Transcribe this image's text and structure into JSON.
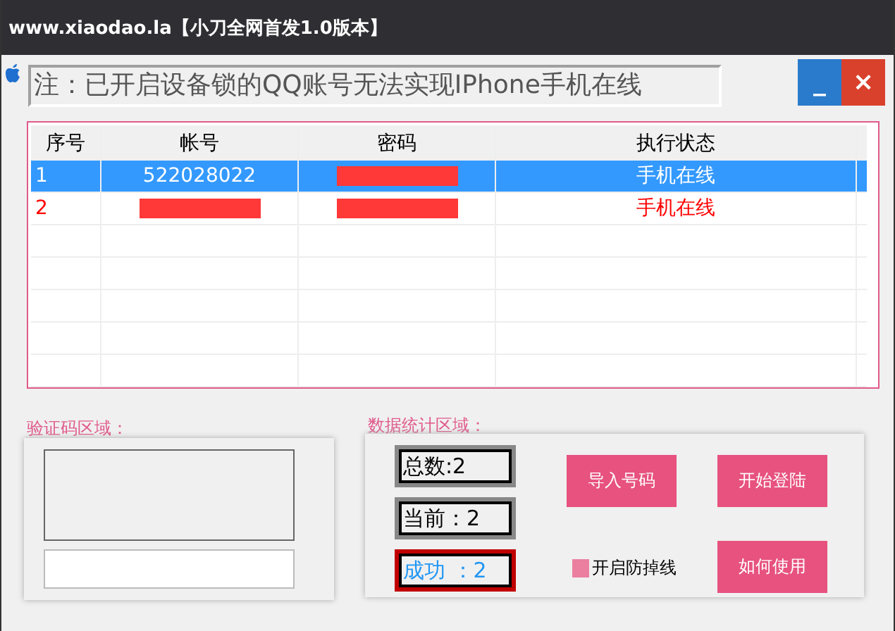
{
  "window": {
    "title": "www.xiaodao.la【小刀全网首发1.0版本】"
  },
  "notice": "注：已开启设备锁的QQ账号无法实现IPhone手机在线",
  "window_buttons": [
    "_",
    "×"
  ],
  "table": {
    "columns": [
      "序号",
      "帐号",
      "密码",
      "执行状态"
    ],
    "rows": [
      {
        "index": "1",
        "account": "522028022",
        "account_redacted": false,
        "password_redacted": true,
        "status": "手机在线",
        "selected": true,
        "color": "#ffffff"
      },
      {
        "index": "2",
        "account_redacted": true,
        "password_redacted": true,
        "status": "手机在线",
        "selected": false,
        "color": "#ff0000"
      }
    ]
  },
  "captcha_group": {
    "label": "验证码区域："
  },
  "stats_group": {
    "label": "数据统计区域：",
    "stats": [
      {
        "text": "总数:2",
        "highlight": false
      },
      {
        "text": "当前：2",
        "highlight": false
      },
      {
        "text": "成功 ：2",
        "highlight": true
      }
    ],
    "buttons": [
      "导入号码",
      "开始登陆",
      "如何使用"
    ],
    "checkbox": {
      "label": "开启防掉线",
      "checked": false
    }
  }
}
